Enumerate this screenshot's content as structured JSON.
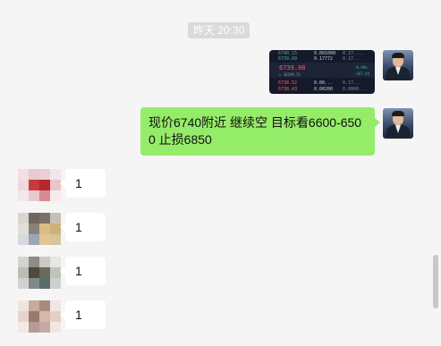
{
  "timestamp": "昨天 20:30",
  "messages": [
    {
      "side": "right",
      "kind": "image",
      "image_text": {
        "row1": [
          "6740.15",
          "0.001000",
          "0.17...."
        ],
        "row2": [
          "6739.09",
          "0.17772",
          "0.17..."
        ],
        "price": "6739.08",
        "sub": "≈ 46299.51",
        "pct": "-0.99%",
        "pct2": "-167.44",
        "row3": [
          "6738.52",
          "0.00...",
          "0.17..."
        ],
        "row4": [
          "6738.43",
          "0.00200",
          "0.0000..."
        ]
      }
    },
    {
      "side": "right",
      "kind": "text",
      "text": "现价6740附近  继续空  目标看6600-6500 止损6850"
    },
    {
      "side": "left",
      "kind": "text",
      "text": "1"
    },
    {
      "side": "left",
      "kind": "text",
      "text": "1"
    },
    {
      "side": "left",
      "kind": "text",
      "text": "1"
    },
    {
      "side": "left",
      "kind": "text",
      "text": "1"
    }
  ],
  "icons": {
    "self_avatar": "businessman-avatar-icon",
    "other_avatar": "pixelated-avatar-icon"
  },
  "colors": {
    "background": "#f5f5f5",
    "self_bubble": "#95ec69",
    "other_bubble": "#ffffff",
    "time_badge": "#dadada"
  }
}
